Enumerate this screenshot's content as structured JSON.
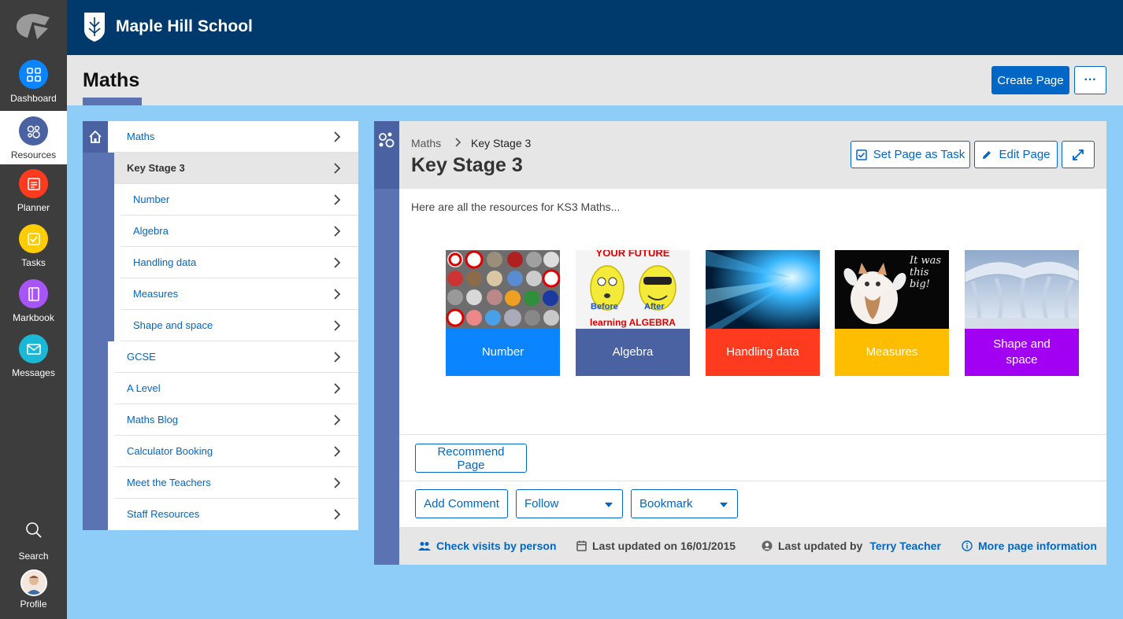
{
  "app": {
    "school_name": "Maple Hill School"
  },
  "rail": {
    "items": [
      {
        "label": "Dashboard",
        "icon": "dashboard-icon",
        "color": "#0a84ff"
      },
      {
        "label": "Resources",
        "icon": "resources-icon",
        "color": "#4b62a2"
      },
      {
        "label": "Planner",
        "icon": "planner-icon",
        "color": "#ff3b1f"
      },
      {
        "label": "Tasks",
        "icon": "tasks-icon",
        "color": "#ffcc00"
      },
      {
        "label": "Markbook",
        "icon": "markbook-icon",
        "color": "#a855f7"
      },
      {
        "label": "Messages",
        "icon": "messages-icon",
        "color": "#1ab8d6"
      }
    ],
    "search_label": "Search",
    "profile_label": "Profile"
  },
  "header": {
    "title": "Maths",
    "create_page_label": "Create Page",
    "more_label": "···"
  },
  "nav": {
    "items": [
      {
        "label": "Maths"
      },
      {
        "label": "Key Stage 3"
      },
      {
        "label": "Number"
      },
      {
        "label": "Algebra"
      },
      {
        "label": "Handling data"
      },
      {
        "label": "Measures"
      },
      {
        "label": "Shape and space"
      },
      {
        "label": "GCSE"
      },
      {
        "label": "A Level"
      },
      {
        "label": "Maths Blog"
      },
      {
        "label": "Calculator Booking"
      },
      {
        "label": "Meet the Teachers"
      },
      {
        "label": "Staff Resources"
      }
    ]
  },
  "page": {
    "breadcrumb_root": "Maths",
    "breadcrumb_current": "Key Stage 3",
    "title": "Key Stage 3",
    "set_task_label": "Set Page as Task",
    "edit_label": "Edit Page",
    "intro": "Here are all the resources for KS3 Maths...",
    "tiles": [
      {
        "caption": "Number",
        "color": "#0a84ff"
      },
      {
        "caption": "Algebra",
        "color": "#4b62a2"
      },
      {
        "caption": "Handling data",
        "color": "#ff3b1f"
      },
      {
        "caption": "Measures",
        "color": "#ffbd00"
      },
      {
        "caption": "Shape and space",
        "color": "#a100f2"
      }
    ],
    "algebra_img_top": "YOUR FUTURE",
    "algebra_img_before": "Before",
    "algebra_img_after": "After",
    "algebra_img_bottom": "learning ALGEBRA",
    "measures_img_text": "It was this big!",
    "recommend_label": "Recommend Page",
    "add_comment_label": "Add Comment",
    "follow_label": "Follow",
    "bookmark_label": "Bookmark"
  },
  "footer": {
    "check_visits": "Check visits by person",
    "last_updated_on": "Last updated on 16/01/2015",
    "last_updated_by": "Last updated by",
    "author": "Terry Teacher",
    "more_info": "More page information"
  }
}
